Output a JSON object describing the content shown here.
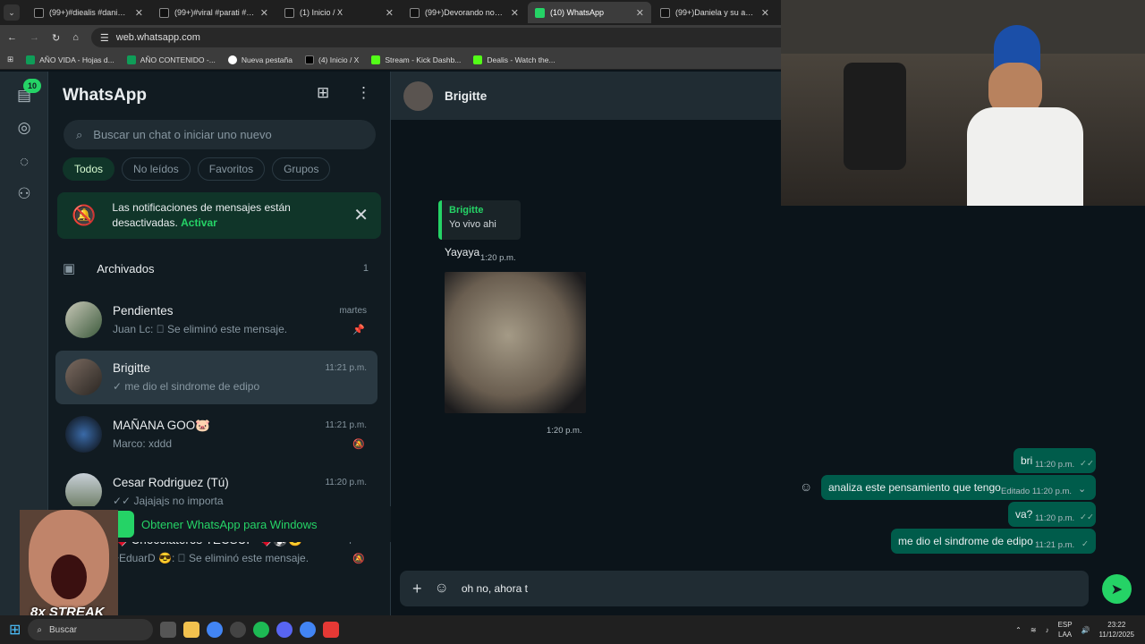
{
  "browser": {
    "tabs": [
      {
        "label": "(99+)#diealis #danielatacq",
        "active": false
      },
      {
        "label": "(99+)#viral #parati #kickp",
        "active": false
      },
      {
        "label": "(1) Inicio / X",
        "active": false
      },
      {
        "label": "(99+)Devorando normal",
        "active": false
      },
      {
        "label": "(10) WhatsApp",
        "active": true
      },
      {
        "label": "(99+)Daniela y su atracció",
        "active": false
      }
    ],
    "url": "web.whatsapp.com",
    "bookmarks": [
      {
        "label": "AÑO VIDA - Hojas d...",
        "color": "#0f9d58"
      },
      {
        "label": "AÑO CONTENIDO -...",
        "color": "#0f9d58"
      },
      {
        "label": "Nueva pestaña",
        "color": "#ffffff"
      },
      {
        "label": "(4) Inicio / X",
        "color": "#000000"
      },
      {
        "label": "Stream - Kick Dashb...",
        "color": "#53fc18"
      },
      {
        "label": "Dealis - Watch the...",
        "color": "#53fc18"
      }
    ]
  },
  "rail": {
    "badge": "10"
  },
  "sidebar": {
    "title": "WhatsApp",
    "search_placeholder": "Buscar un chat o iniciar uno nuevo",
    "filters": [
      "Todos",
      "No leídos",
      "Favoritos",
      "Grupos"
    ],
    "notification": {
      "text": "Las notificaciones de mensajes están desactivadas.",
      "action": "Activar"
    },
    "archived": {
      "label": "Archivados",
      "count": "1"
    },
    "chats": [
      {
        "name": "Pendientes",
        "time": "martes",
        "msg": "Juan Lc: ⃠ Se eliminó este mensaje.",
        "icon": "pin-icon"
      },
      {
        "name": "Brigitte",
        "time": "11:21 p.m.",
        "msg": "✓ me dio el sindrome de edipo",
        "icon": ""
      },
      {
        "name": "MAÑANA GOO🐷",
        "time": "11:21 p.m.",
        "msg": "Marco: xddd",
        "icon": "muted-icon"
      },
      {
        "name": "Cesar Rodriguez (Tú)",
        "time": "11:20 p.m.",
        "msg": "✓✓ Jajajajs no importa",
        "icon": ""
      },
      {
        "name": "🍫 Chocolateros TECSUP 🍫⚽😎",
        "time": "11:19 p.m.",
        "msg": "~EduarD 😎: ⃠ Se eliminó este mensaje.",
        "icon": "muted-icon"
      }
    ],
    "get_app": "Obtener WhatsApp para Windows"
  },
  "conversation": {
    "contact": "Brigitte",
    "quote": {
      "author": "Brigitte",
      "text": "Yo vivo ahi"
    },
    "incoming": [
      {
        "text": "Yayaya",
        "time": "1:20 p.m."
      },
      {
        "text": "",
        "time": "1:20 p.m."
      }
    ],
    "outgoing": [
      {
        "text": "bri",
        "time": "11:20 p.m."
      },
      {
        "text": "analiza este pensamiento que tengo",
        "time": "Editado 11:20 p.m."
      },
      {
        "text": "va?",
        "time": "11:20 p.m."
      },
      {
        "text": "me dio el sindrome de edipo",
        "time": "11:21 p.m."
      }
    ],
    "compose_value": "oh no, ahora t"
  },
  "overlay": {
    "streak": "8x STREAK"
  },
  "taskbar": {
    "search": "Buscar",
    "lang": "ESP",
    "lang2": "LAA",
    "time": "23:22",
    "date": "11/12/2025"
  },
  "colors": {
    "accent": "#25d366",
    "outgoing": "#005c4b",
    "panel": "#111b21"
  }
}
